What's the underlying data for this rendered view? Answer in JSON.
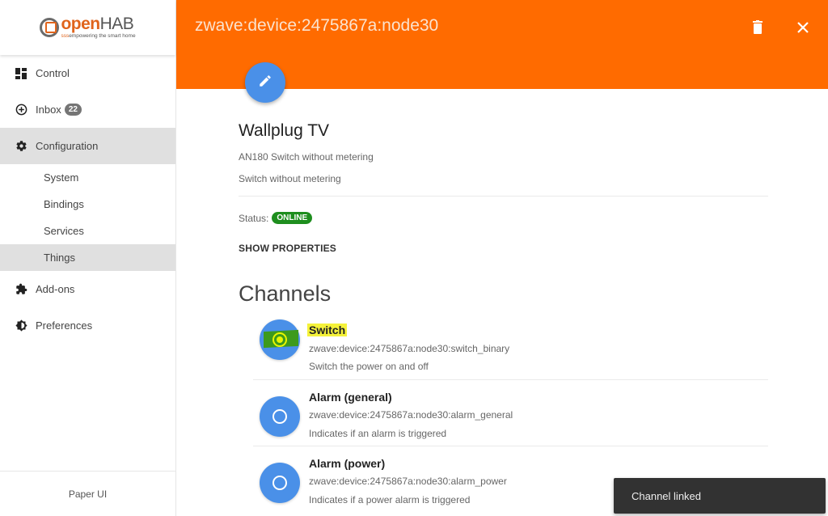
{
  "app": {
    "logo_word_open": "open",
    "logo_word_hab": "HAB",
    "logo_tag_prefix": "sss",
    "logo_tag": "empowering the smart home",
    "footer": "Paper UI"
  },
  "sidebar": {
    "items": [
      {
        "label": "Control",
        "icon": "dashboard-icon"
      },
      {
        "label": "Inbox",
        "icon": "add-circle-icon",
        "badge": "22"
      },
      {
        "label": "Configuration",
        "icon": "gear-icon",
        "active": true
      },
      {
        "label": "Add-ons",
        "icon": "puzzle-icon"
      },
      {
        "label": "Preferences",
        "icon": "brightness-icon"
      }
    ],
    "sub_items": [
      {
        "label": "System"
      },
      {
        "label": "Bindings"
      },
      {
        "label": "Services"
      },
      {
        "label": "Things",
        "active": true
      }
    ]
  },
  "header": {
    "title": "zwave:device:2475867a:node30",
    "delete_icon": "trash-icon",
    "close_icon": "close-icon",
    "color": "#ff6b00"
  },
  "thing": {
    "name": "Wallplug TV",
    "label": "AN180 Switch without metering",
    "description": "Switch without metering",
    "status_label": "Status:",
    "status": "ONLINE",
    "status_color": "#1e8e1e",
    "show_properties": "SHOW PROPERTIES"
  },
  "channels": {
    "title": "Channels",
    "items": [
      {
        "label": "Switch",
        "uid": "zwave:device:2475867a:node30:switch_binary",
        "description": "Switch the power on and off",
        "linked": true
      },
      {
        "label": "Alarm (general)",
        "uid": "zwave:device:2475867a:node30:alarm_general",
        "description": "Indicates if an alarm is triggered",
        "linked": false
      },
      {
        "label": "Alarm (power)",
        "uid": "zwave:device:2475867a:node30:alarm_power",
        "description": "Indicates if a power alarm is triggered",
        "linked": false
      }
    ]
  },
  "toast": {
    "message": "Channel linked"
  }
}
